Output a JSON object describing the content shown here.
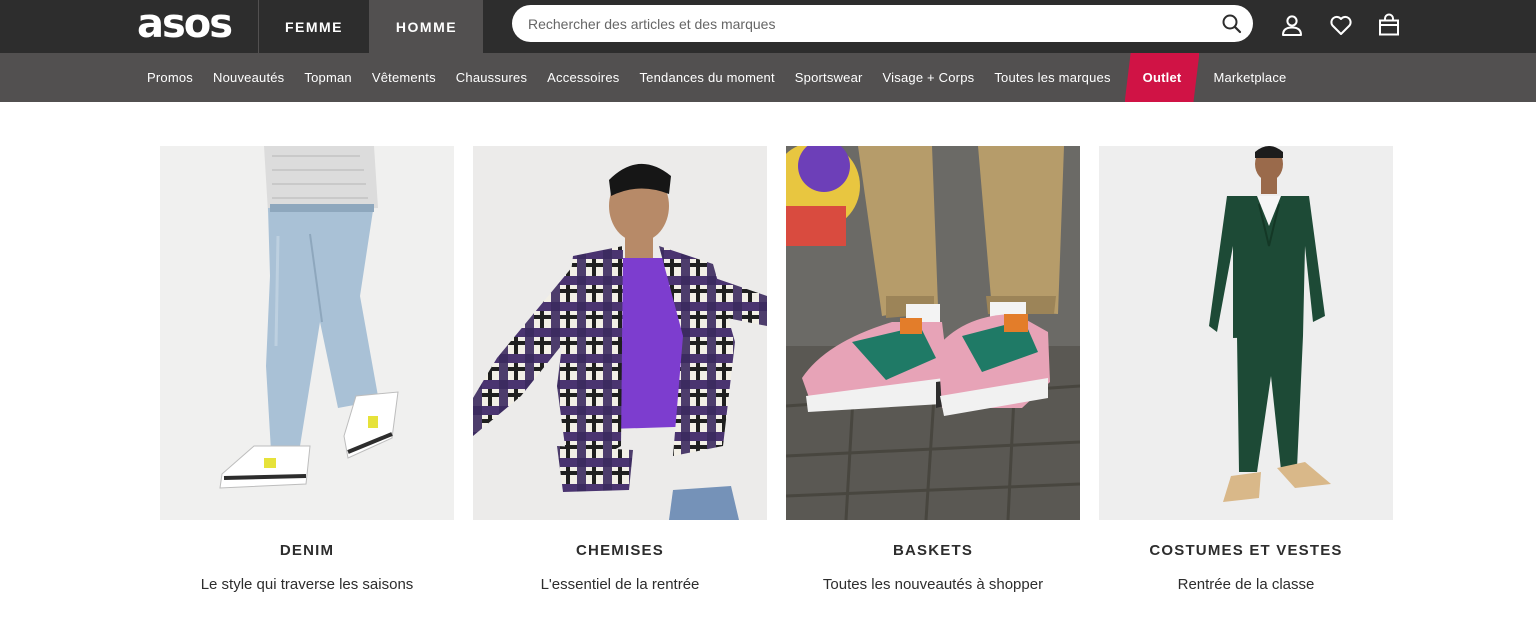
{
  "header": {
    "logo_text": "asos",
    "tabs": [
      {
        "label": "FEMME",
        "active": false
      },
      {
        "label": "HOMME",
        "active": true
      }
    ],
    "search": {
      "placeholder": "Rechercher des articles et des marques",
      "value": ""
    },
    "icons": [
      "search-icon",
      "user-icon",
      "heart-icon",
      "bag-icon"
    ]
  },
  "nav": {
    "items": [
      {
        "label": "Promos"
      },
      {
        "label": "Nouveautés"
      },
      {
        "label": "Topman"
      },
      {
        "label": "Vêtements"
      },
      {
        "label": "Chaussures"
      },
      {
        "label": "Accessoires"
      },
      {
        "label": "Tendances du moment"
      },
      {
        "label": "Sportswear"
      },
      {
        "label": "Visage + Corps"
      },
      {
        "label": "Toutes les marques"
      },
      {
        "label": "Outlet",
        "highlight": true
      },
      {
        "label": "Marketplace"
      }
    ]
  },
  "cards": [
    {
      "title": "DENIM",
      "subtitle": "Le style qui traverse les saisons"
    },
    {
      "title": "CHEMISES",
      "subtitle": "L'essentiel de la rentrée"
    },
    {
      "title": "BASKETS",
      "subtitle": "Toutes les nouveautés à shopper"
    },
    {
      "title": "COSTUMES ET VESTES",
      "subtitle": "Rentrée de la classe"
    }
  ],
  "colors": {
    "topbar": "#2d2d2d",
    "nav": "#525050",
    "outlet": "#d01345",
    "text": "#2d2d2d"
  }
}
